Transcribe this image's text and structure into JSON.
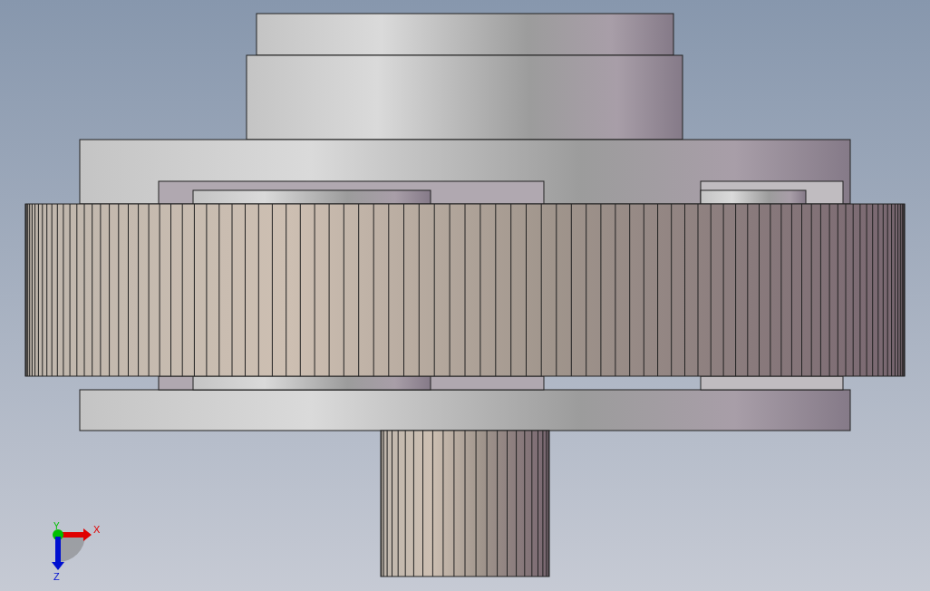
{
  "viewport": {
    "triad": {
      "axes": [
        {
          "label": "X",
          "kind": "right",
          "color": "#e00000"
        },
        {
          "label": "Y",
          "kind": "point",
          "color": "#00c000"
        },
        {
          "label": "Z",
          "kind": "down",
          "color": "#0010d0"
        }
      ]
    }
  }
}
